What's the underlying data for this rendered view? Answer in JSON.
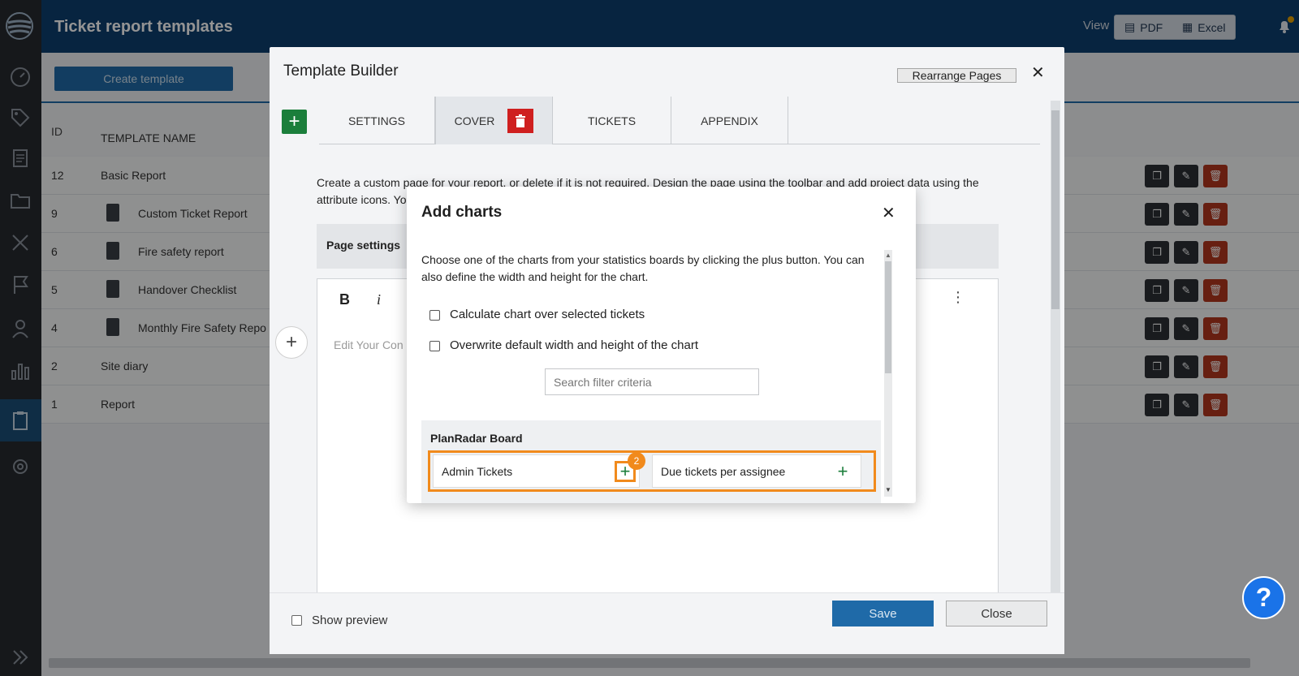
{
  "header": {
    "title": "Ticket report templates",
    "view_label": "View",
    "pdf_label": "PDF",
    "excel_label": "Excel"
  },
  "page": {
    "create_template": "Create template",
    "columns": {
      "id": "ID",
      "name": "TEMPLATE NAME"
    },
    "rows": [
      {
        "id": "12",
        "name": "Basic Report",
        "has_icon": false
      },
      {
        "id": "9",
        "name": "Custom Ticket Report",
        "has_icon": true
      },
      {
        "id": "6",
        "name": "Fire safety report",
        "has_icon": true
      },
      {
        "id": "5",
        "name": "Handover Checklist",
        "has_icon": true
      },
      {
        "id": "4",
        "name": "Monthly Fire Safety Repo",
        "has_icon": true
      },
      {
        "id": "2",
        "name": "Site diary",
        "has_icon": false
      },
      {
        "id": "1",
        "name": "Report",
        "has_icon": false
      }
    ]
  },
  "template_builder": {
    "title": "Template Builder",
    "rearrange_label": "Rearrange Pages",
    "close_symbol": "✕",
    "add_symbol": "+",
    "tabs": [
      {
        "label": "SETTINGS"
      },
      {
        "label": "COVER"
      },
      {
        "label": "TICKETS"
      },
      {
        "label": "APPENDIX"
      }
    ],
    "description": "Create a custom page for your report, or delete if it is not required. Design the page using the toolbar and add project data using the attribute icons. Yo",
    "page_settings": "Page settings",
    "editor": {
      "bold": "B",
      "italic": "i",
      "more": "⋮",
      "placeholder": "Edit Your Con"
    },
    "float_plus": "+",
    "footer": {
      "show_preview": "Show preview",
      "save": "Save",
      "close": "Close"
    }
  },
  "add_charts": {
    "title": "Add charts",
    "close_symbol": "✕",
    "description": "Choose one of the charts from your statistics boards by clicking the plus button. You can also define the width and height for the chart.",
    "checkbox_1": "Calculate chart over selected tickets",
    "checkbox_2": "Overwrite default width and height of the chart",
    "search_placeholder": "Search filter criteria",
    "board": {
      "name": "PlanRadar Board",
      "charts": [
        {
          "name": "Admin Tickets"
        },
        {
          "name": "Due tickets per assignee"
        }
      ]
    },
    "plus_symbol": "+",
    "step_number": "2",
    "scroll_up": "▲",
    "scroll_down": "▼"
  },
  "help": {
    "symbol": "?"
  },
  "colors": {
    "header_bg": "#0d3f6e",
    "sidebar_bg": "#262a30",
    "primary": "#1f6aa8",
    "add_green": "#1b7e3b",
    "delete_red": "#cf1f1f",
    "highlight_orange": "#f18a1c"
  }
}
